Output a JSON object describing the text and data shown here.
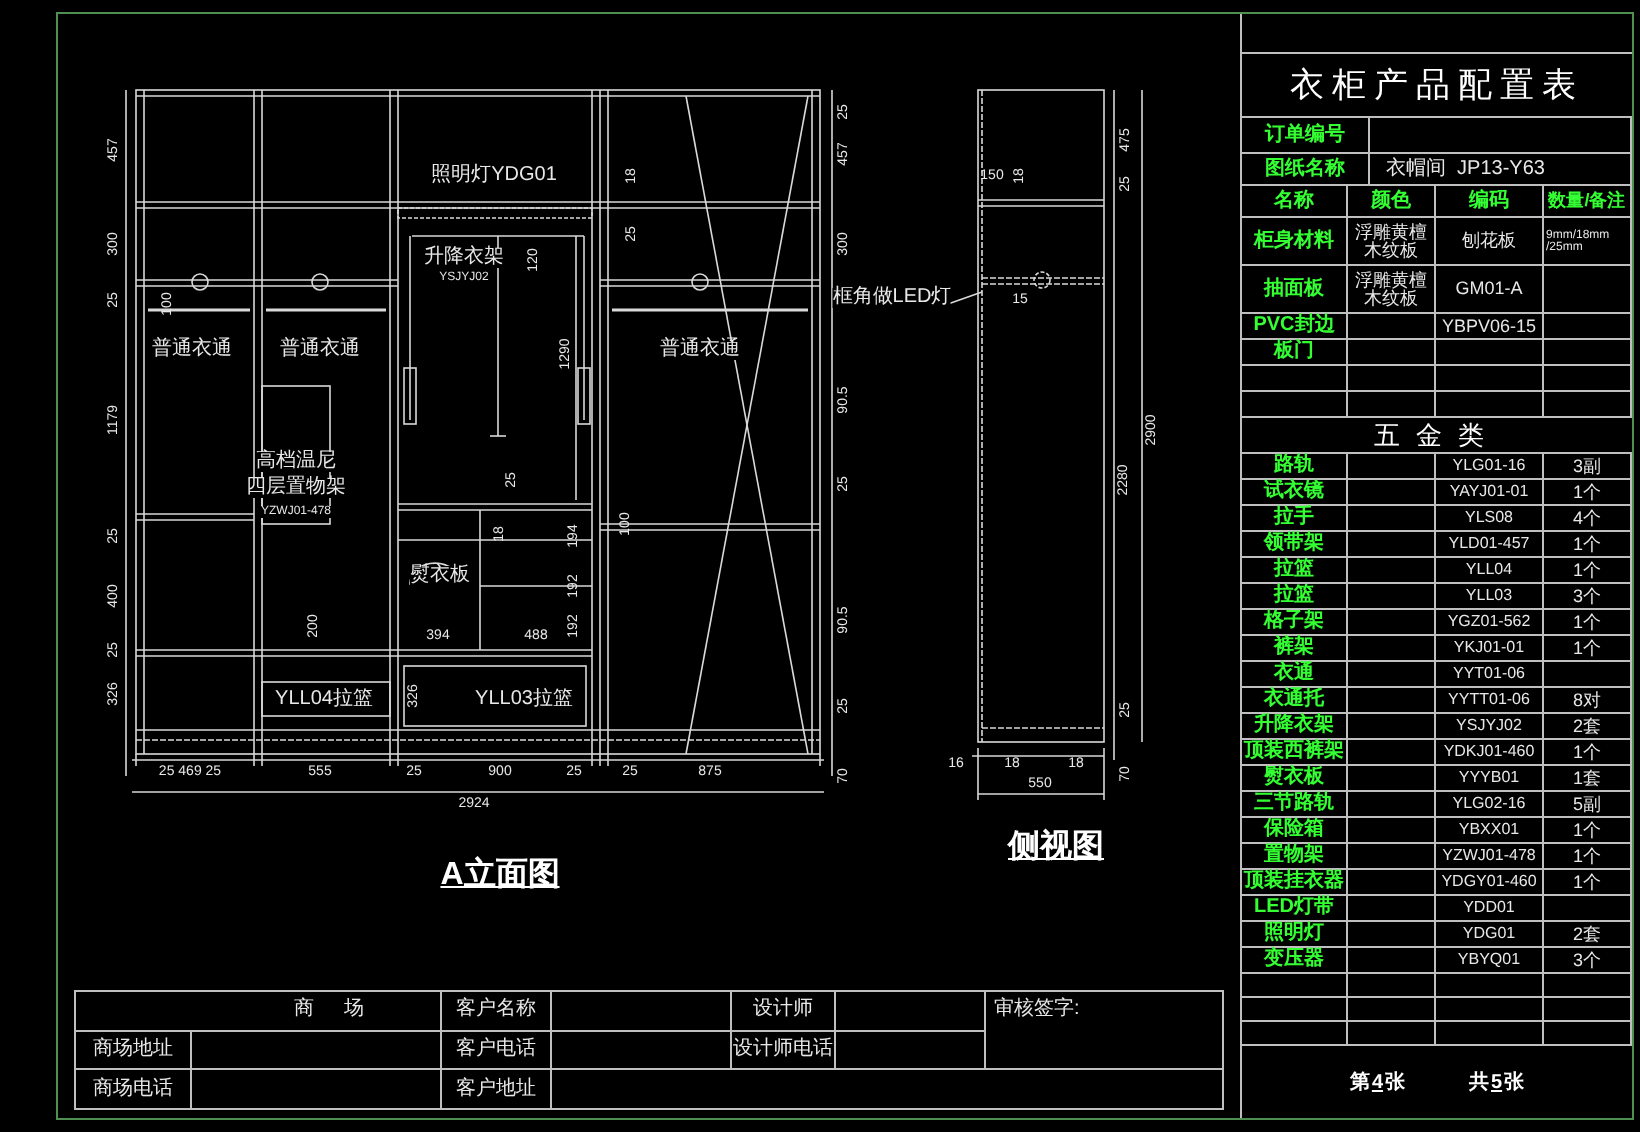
{
  "elevation": {
    "title": "A立面图",
    "labels": [
      {
        "kind": "dimension",
        "text": "25"
      },
      {
        "kind": "dimension",
        "text": "457"
      },
      {
        "kind": "dimension",
        "text": "457"
      },
      {
        "kind": "note",
        "text": "照明灯YDG01"
      },
      {
        "kind": "dimension",
        "text": "18"
      },
      {
        "kind": "dimension",
        "text": "25"
      },
      {
        "kind": "dimension",
        "text": "300"
      },
      {
        "kind": "dimension",
        "text": "300"
      },
      {
        "kind": "note",
        "text": "升降衣架"
      },
      {
        "kind": "dimension",
        "text": "120"
      },
      {
        "kind": "code",
        "text": "YSJYJ02"
      },
      {
        "kind": "dimension",
        "text": "25"
      },
      {
        "kind": "dimension",
        "text": "100"
      },
      {
        "kind": "note",
        "text": "普通衣通"
      },
      {
        "kind": "note",
        "text": "普通衣通"
      },
      {
        "kind": "note",
        "text": "普通衣通"
      },
      {
        "kind": "dimension",
        "text": "1290"
      },
      {
        "kind": "dimension",
        "text": "90.5"
      },
      {
        "kind": "dimension",
        "text": "1179"
      },
      {
        "kind": "note",
        "text": "高档温尼"
      },
      {
        "kind": "dimension",
        "text": "25"
      },
      {
        "kind": "dimension",
        "text": "25"
      },
      {
        "kind": "note",
        "text": "四层置物架"
      },
      {
        "kind": "code",
        "text": "YZWJ01-478"
      },
      {
        "kind": "dimension",
        "text": "100"
      },
      {
        "kind": "dimension",
        "text": "18"
      },
      {
        "kind": "dimension",
        "text": "25"
      },
      {
        "kind": "dimension",
        "text": "194"
      },
      {
        "kind": "note",
        "text": "熨衣板"
      },
      {
        "kind": "dimension",
        "text": "192"
      },
      {
        "kind": "dimension",
        "text": "400"
      },
      {
        "kind": "dimension",
        "text": "90.5"
      },
      {
        "kind": "dimension",
        "text": "200"
      },
      {
        "kind": "dimension",
        "text": "192"
      },
      {
        "kind": "dimension",
        "text": "394"
      },
      {
        "kind": "dimension",
        "text": "488"
      },
      {
        "kind": "dimension",
        "text": "25"
      },
      {
        "kind": "dimension",
        "text": "326"
      },
      {
        "kind": "dimension",
        "text": "326"
      },
      {
        "kind": "note",
        "text": "YLL04拉篮"
      },
      {
        "kind": "note",
        "text": "YLL03拉篮"
      },
      {
        "kind": "dimension",
        "text": "25"
      },
      {
        "kind": "dimension",
        "text": "25 469 25"
      },
      {
        "kind": "dimension",
        "text": "555"
      },
      {
        "kind": "dimension",
        "text": "25"
      },
      {
        "kind": "dimension",
        "text": "900"
      },
      {
        "kind": "dimension",
        "text": "25"
      },
      {
        "kind": "dimension",
        "text": "25"
      },
      {
        "kind": "dimension",
        "text": "875"
      },
      {
        "kind": "dimension",
        "text": "70"
      },
      {
        "kind": "dimension",
        "text": "2924"
      }
    ]
  },
  "side_view": {
    "title": "侧视图",
    "labels": [
      {
        "kind": "dimension",
        "text": "475"
      },
      {
        "kind": "dimension",
        "text": "150"
      },
      {
        "kind": "dimension",
        "text": "18"
      },
      {
        "kind": "dimension",
        "text": "25"
      },
      {
        "kind": "note",
        "text": "框角做LED灯"
      },
      {
        "kind": "dimension",
        "text": "15"
      },
      {
        "kind": "dimension",
        "text": "2900"
      },
      {
        "kind": "dimension",
        "text": "2280"
      },
      {
        "kind": "dimension",
        "text": "25"
      },
      {
        "kind": "dimension",
        "text": "70"
      },
      {
        "kind": "dimension",
        "text": "16"
      },
      {
        "kind": "dimension",
        "text": "18"
      },
      {
        "kind": "dimension",
        "text": "18"
      },
      {
        "kind": "dimension",
        "text": "550"
      }
    ]
  },
  "title_block": {
    "labels": [
      "商 场",
      "客户名称",
      "设计师",
      "审核签字:",
      "商场地址",
      "客户电话",
      "设计师电话",
      "商场电话",
      "客户地址"
    ]
  },
  "config_table": {
    "title": "衣柜产品配置表",
    "order_no": {
      "label": "订单编号"
    },
    "drawing_name": {
      "label": "图纸名称",
      "value": "衣帽间  JP13-Y63"
    },
    "columns": [
      "名称",
      "颜色",
      "编码",
      "数量/备注"
    ],
    "materials": [
      {
        "name": "柜身材料",
        "finish": "浮雕黄檀木纹板",
        "code": "刨花板",
        "qty": "9mm/18mm /25mm"
      },
      {
        "name": "抽面板",
        "finish": "浮雕黄檀木纹板",
        "code": "GM01-A"
      },
      {
        "name": "PVC封边",
        "code": "YBPV06-15"
      },
      {
        "name": "板门"
      }
    ],
    "hardware_title": "五金类",
    "hardware": [
      {
        "name": "路轨",
        "code": "YLG01-16",
        "qty": "3副"
      },
      {
        "name": "试衣镜",
        "code": "YAYJ01-01",
        "qty": "1个"
      },
      {
        "name": "拉手",
        "code": "YLS08",
        "qty": "4个"
      },
      {
        "name": "领带架",
        "code": "YLD01-457",
        "qty": "1个"
      },
      {
        "name": "拉篮",
        "code": "YLL04",
        "qty": "1个"
      },
      {
        "name": "拉篮",
        "code": "YLL03",
        "qty": "3个"
      },
      {
        "name": "格子架",
        "code": "YGZ01-562",
        "qty": "1个"
      },
      {
        "name": "裤架",
        "code": "YKJ01-01",
        "qty": "1个"
      },
      {
        "name": "衣通",
        "code": "YYT01-06"
      },
      {
        "name": "衣通托",
        "code": "YYTT01-06",
        "qty": "8对"
      },
      {
        "name": "升降衣架",
        "code": "YSJYJ02",
        "qty": "2套"
      },
      {
        "name": "顶装西裤架",
        "code": "YDKJ01-460",
        "qty": "1个"
      },
      {
        "name": "熨衣板",
        "code": "YYYB01",
        "qty": "1套"
      },
      {
        "name": "三节路轨",
        "code": "YLG02-16",
        "qty": "5副"
      },
      {
        "name": "保险箱",
        "code": "YBXX01",
        "qty": "1个"
      },
      {
        "name": "置物架",
        "code": "YZWJ01-478",
        "qty": "1个"
      },
      {
        "name": "顶装挂衣器",
        "code": "YDGY01-460",
        "qty": "1个"
      },
      {
        "name": "LED灯带",
        "code": "YDD01"
      },
      {
        "name": "照明灯",
        "code": "YDG01",
        "qty": "2套"
      },
      {
        "name": "变压器",
        "code": "YBYQ01",
        "qty": "3个"
      }
    ],
    "sheet": {
      "prefix": "第",
      "number": "4",
      "suffix": "张"
    },
    "total": {
      "prefix": "共",
      "number": "5",
      "suffix": "张"
    }
  }
}
